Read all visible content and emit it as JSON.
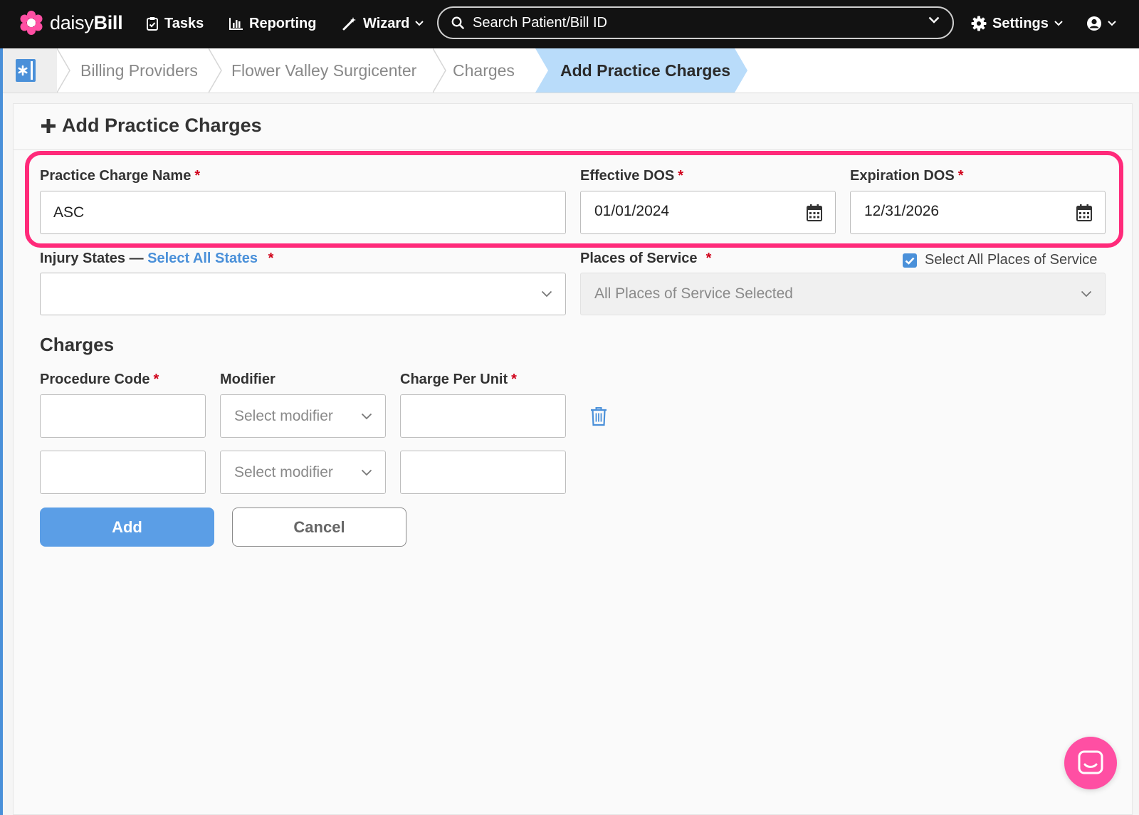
{
  "brand": {
    "name_light": "daisy",
    "name_bold": "Bill",
    "accent": "#ff4fa3"
  },
  "nav": {
    "tasks": "Tasks",
    "reporting": "Reporting",
    "wizard": "Wizard",
    "search_placeholder": "Search Patient/Bill ID",
    "settings": "Settings"
  },
  "breadcrumb": {
    "items": [
      "Billing Providers",
      "Flower Valley Surgicenter",
      "Charges"
    ],
    "active": "Add Practice Charges"
  },
  "page": {
    "title": "Add Practice Charges"
  },
  "form": {
    "charge_name": {
      "label": "Practice Charge Name",
      "required": "*",
      "value": "ASC"
    },
    "effective_dos": {
      "label": "Effective DOS",
      "required": "*",
      "value": "01/01/2024"
    },
    "expiration_dos": {
      "label": "Expiration DOS",
      "required": "*",
      "value": "12/31/2026"
    },
    "injury_states": {
      "label": "Injury States —",
      "link": "Select All States",
      "required": "*",
      "value": ""
    },
    "places_of_service": {
      "label": "Places of Service",
      "required": "*",
      "select_all_label": "Select All Places of Service",
      "select_all_checked": true,
      "value": "All Places of Service Selected"
    }
  },
  "charges": {
    "title": "Charges",
    "headers": {
      "procedure_code": "Procedure Code",
      "modifier": "Modifier",
      "charge_per_unit": "Charge Per Unit",
      "required": "*"
    },
    "rows": [
      {
        "procedure_code": "",
        "modifier_placeholder": "Select modifier",
        "charge_per_unit": ""
      },
      {
        "procedure_code": "",
        "modifier_placeholder": "Select modifier",
        "charge_per_unit": ""
      }
    ]
  },
  "actions": {
    "add": "Add",
    "cancel": "Cancel"
  },
  "colors": {
    "highlight": "#ff2a7a",
    "primary": "#5b9ee6",
    "link": "#4a90d9",
    "required": "#d0021b"
  }
}
